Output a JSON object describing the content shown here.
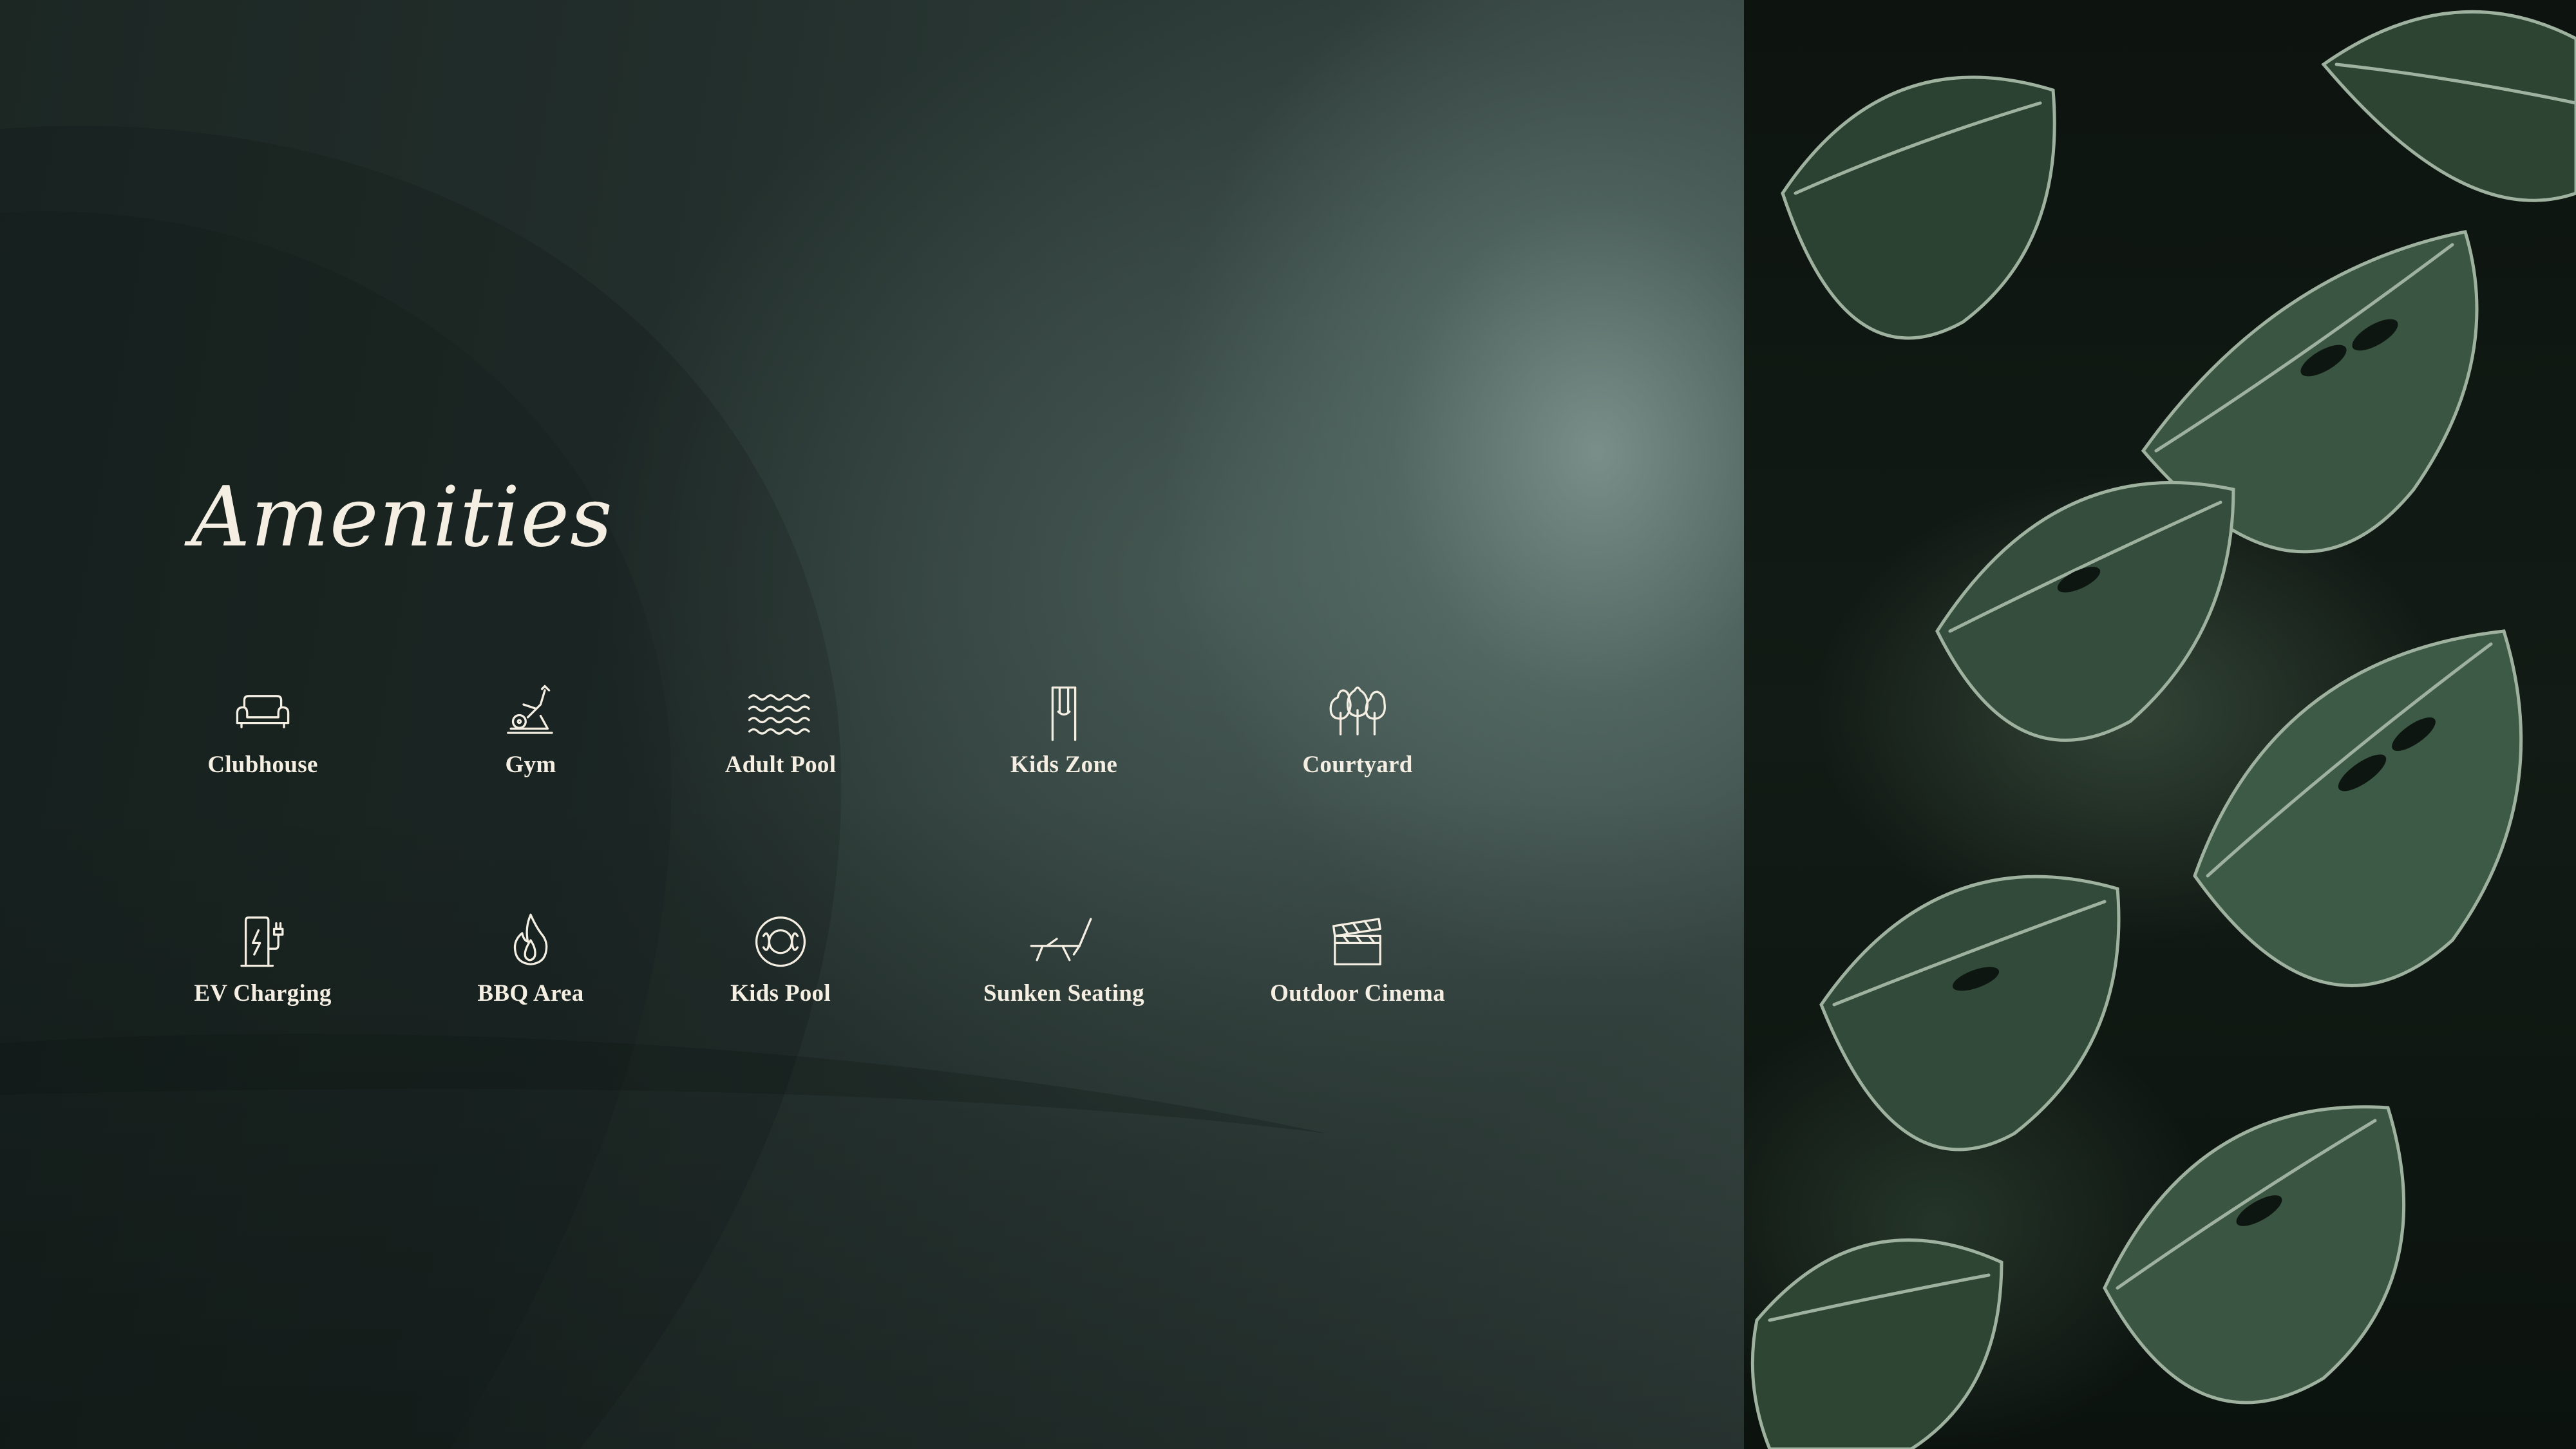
{
  "slide": {
    "title": "Amenities"
  },
  "amenities": [
    {
      "label": "Clubhouse",
      "icon": "sofa-icon"
    },
    {
      "label": "Gym",
      "icon": "exercise-bike-icon"
    },
    {
      "label": "Adult Pool",
      "icon": "water-waves-icon"
    },
    {
      "label": "Kids Zone",
      "icon": "swing-icon"
    },
    {
      "label": "Courtyard",
      "icon": "trees-icon"
    },
    {
      "label": "EV Charging",
      "icon": "ev-charger-icon"
    },
    {
      "label": "BBQ Area",
      "icon": "flame-icon"
    },
    {
      "label": "Kids Pool",
      "icon": "swim-ring-icon"
    },
    {
      "label": "Sunken Seating",
      "icon": "lounge-chair-icon"
    },
    {
      "label": "Outdoor Cinema",
      "icon": "clapperboard-icon"
    }
  ],
  "colors": {
    "text": "#f4efe2",
    "panel_dark": "#1c2724",
    "panel_highlight": "#8fa7a1",
    "leaf_green": "#3f5a45"
  }
}
